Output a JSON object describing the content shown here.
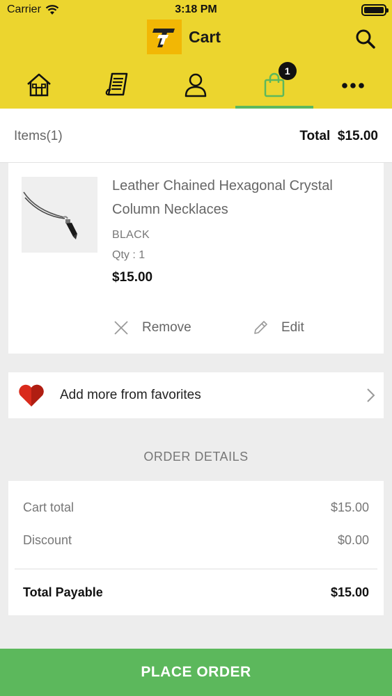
{
  "status_bar": {
    "carrier": "Carrier",
    "time": "3:18 PM"
  },
  "header": {
    "title": "Cart",
    "logo_text": "T"
  },
  "nav": {
    "items": [
      {
        "name": "home-icon"
      },
      {
        "name": "orders-icon"
      },
      {
        "name": "profile-icon"
      },
      {
        "name": "cart-bag-icon",
        "badge": "1",
        "active": true
      },
      {
        "name": "more-icon"
      }
    ]
  },
  "summary": {
    "items_label": "Items(1)",
    "total_label": "Total",
    "total_value": "$15.00"
  },
  "product": {
    "name": "Leather Chained Hexagonal Crystal Column Necklaces",
    "color": "BLACK",
    "qty": "Qty : 1",
    "price": "$15.00",
    "remove_label": "Remove",
    "edit_label": "Edit"
  },
  "favorites": {
    "label": "Add more from favorites"
  },
  "order_details": {
    "title": "ORDER DETAILS",
    "rows": [
      {
        "label": "Cart total",
        "value": "$15.00"
      },
      {
        "label": "Discount",
        "value": "$0.00"
      }
    ],
    "total": {
      "label": "Total Payable",
      "value": "$15.00"
    }
  },
  "cta": {
    "place_order": "PLACE ORDER"
  },
  "colors": {
    "header_bg": "#ecd52e",
    "accent_green": "#5cb85c",
    "logo_bg": "#f2b705"
  }
}
